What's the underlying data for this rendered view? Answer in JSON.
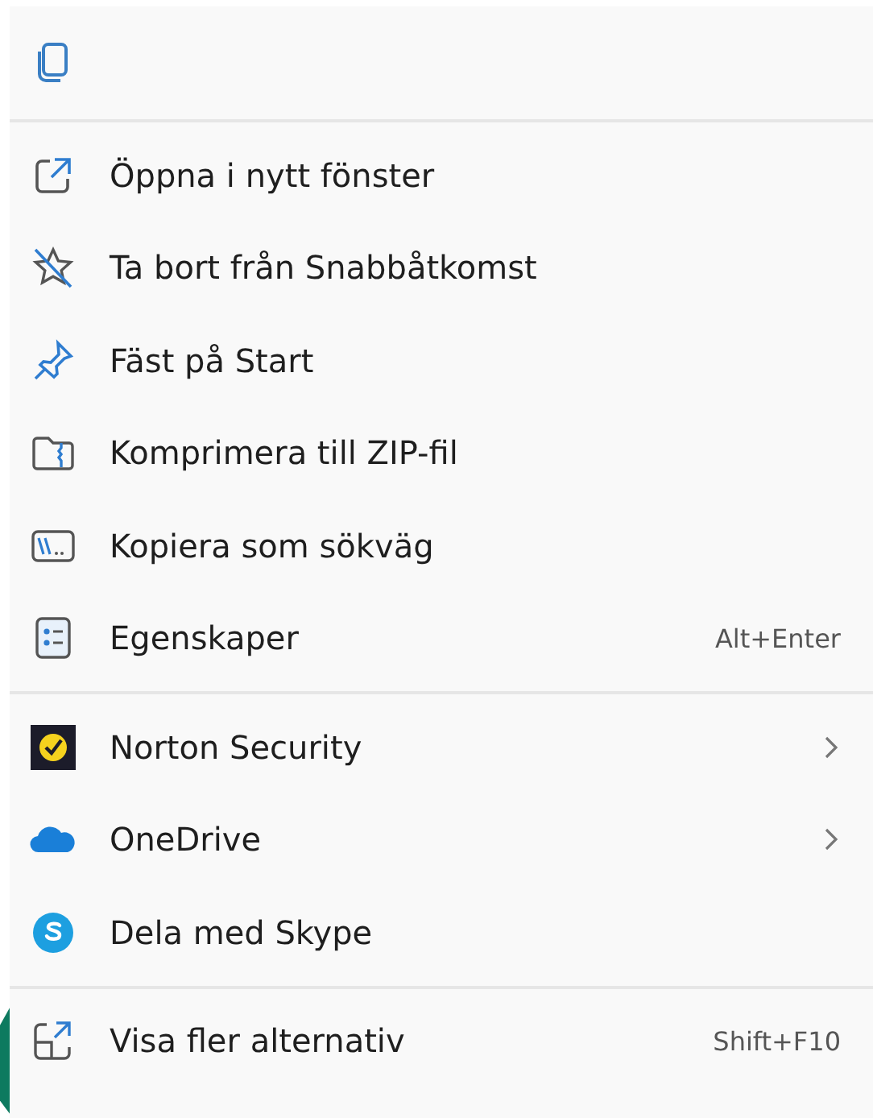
{
  "sections": [
    {
      "items": [
        {
          "label": "Öppna i nytt fönster",
          "has_submenu": false
        },
        {
          "label": "Ta bort från Snabbåtkomst",
          "has_submenu": false
        },
        {
          "label": "Fäst på Start",
          "has_submenu": false
        },
        {
          "label": "Komprimera till ZIP-fil",
          "has_submenu": false
        },
        {
          "label": "Kopiera som sökväg",
          "has_submenu": false
        },
        {
          "label": "Egenskaper",
          "shortcut": "Alt+Enter",
          "has_submenu": false
        }
      ]
    },
    {
      "items": [
        {
          "label": "Norton Security",
          "has_submenu": true
        },
        {
          "label": "OneDrive",
          "has_submenu": true
        },
        {
          "label": "Dela med Skype",
          "has_submenu": false
        }
      ]
    },
    {
      "items": [
        {
          "label": "Visa fler alternativ",
          "shortcut": "Shift+F10",
          "has_submenu": false
        }
      ]
    }
  ]
}
